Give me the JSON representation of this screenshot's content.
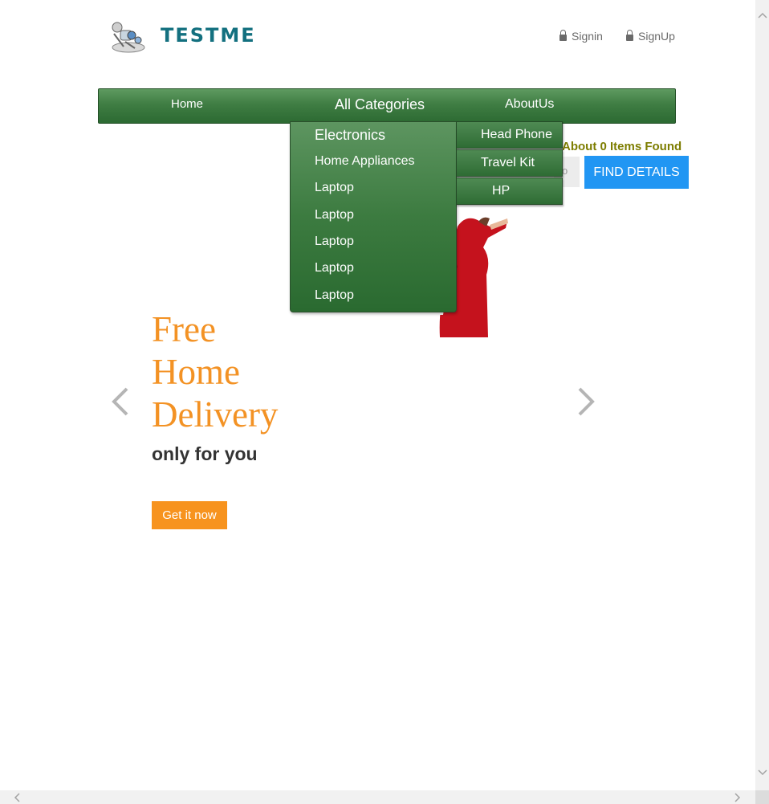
{
  "header": {
    "brand": "TESTME",
    "signin_label": "Signin",
    "signup_label": "SignUp"
  },
  "nav": {
    "home": "Home",
    "categories": "All Categories",
    "about": "AboutUs"
  },
  "dropdown": {
    "items": [
      "Electronics",
      "Home Appliances",
      "Laptop",
      "Laptop",
      "Laptop",
      "Laptop",
      "Laptop"
    ],
    "subitems": [
      "Head Phone",
      "Travel Kit",
      "HP"
    ]
  },
  "search": {
    "result_text": "About 0 Items Found",
    "button_label": "FIND DETAILS",
    "input_fragment": "o"
  },
  "hero": {
    "title_lines": [
      "Free",
      "Home",
      "Delivery"
    ],
    "subtitle": "only for you",
    "cta_label": "Get it now"
  }
}
